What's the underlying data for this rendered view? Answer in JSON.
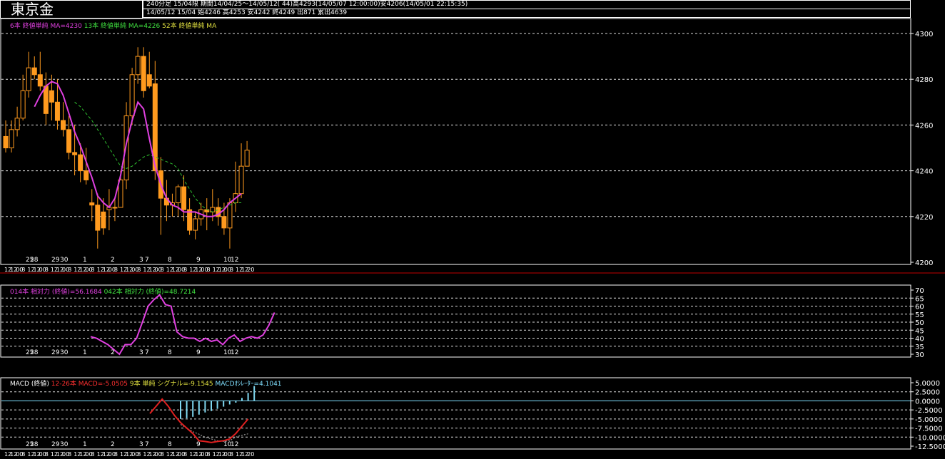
{
  "header": {
    "title": "東京金",
    "row1": "240分足 15/04限 期間14/04/25〜14/05/12( 44)高4293(14/05/07 12:00:00)安4206(14/05/01 22:15:35)",
    "row2": "14/05/12 15/04 始4246 高4253 安4242 終4249 出871 累出4639"
  },
  "colors": {
    "candle": "#ff9a1e",
    "ma6": "#e040e0",
    "ma13": "#30c030",
    "macd": "#e02020",
    "signal": "#b0b0b0",
    "hist": "#80d8f0",
    "frame": "#ffffff",
    "separator": "#c00000"
  },
  "main_panel": {
    "legend": {
      "ma6": "6本 終値単純 MA=4230",
      "ma13": "13本 終値単純 MA=4226",
      "ma52": "52本 終値単純 MA"
    },
    "y_ticks": [
      "4300",
      "4280",
      "4260",
      "4240",
      "4220",
      "4200"
    ],
    "day_labels": [
      "25",
      "28",
      "29",
      "30",
      "1",
      "2",
      "3",
      "7",
      "8",
      "9",
      "10",
      "12"
    ],
    "time_labels": [
      "12",
      "12",
      "00",
      "8",
      "12",
      "12",
      "00",
      "8",
      "12",
      "12",
      "00",
      "8",
      "12",
      "12",
      "00",
      "8",
      "12",
      "12",
      "00",
      "8",
      "12",
      "12",
      "00",
      "8",
      "12",
      "12",
      "00",
      "8",
      "12",
      "12",
      "00",
      "8",
      "12",
      "12",
      "00",
      "8",
      "12",
      "12",
      "00",
      "8",
      "12",
      "12",
      "20"
    ]
  },
  "rsi_panel": {
    "legend": {
      "rsi14": "014本 相対力 (終値)=56.1684",
      "rsi42": "042本 相対力 (終値)=48.7214"
    },
    "y_ticks": [
      "70",
      "65",
      "60",
      "55",
      "50",
      "45",
      "40",
      "35",
      "30"
    ],
    "day_labels": [
      "25",
      "28",
      "29",
      "30",
      "1",
      "2",
      "3",
      "7",
      "8",
      "9",
      "10",
      "12"
    ]
  },
  "macd_panel": {
    "legend": {
      "title": "MACD (終値)",
      "macd": "12-26本 MACD=-5.0505",
      "signal": "9本 単純 シグナル=-9.1545",
      "osc": "MACDｵｼﾚｰﾀｰ=4.1041"
    },
    "y_ticks": [
      "5.0000",
      "2.5000",
      "0.0000",
      "-2.5000",
      "-5.0000",
      "-7.5000",
      "-10.0000",
      "-12.5000"
    ],
    "day_labels": [
      "25",
      "28",
      "29",
      "30",
      "1",
      "2",
      "3",
      "7",
      "8",
      "9",
      "10",
      "12"
    ]
  },
  "chart_data": [
    {
      "type": "candlestick",
      "title": "東京金",
      "ylim": [
        4200,
        4300
      ],
      "series": [
        {
          "name": "price",
          "ohlc": [
            [
              4255,
              4262,
              4248,
              4250
            ],
            [
              4250,
              4262,
              4248,
              4258
            ],
            [
              4258,
              4268,
              4255,
              4263
            ],
            [
              4263,
              4282,
              4262,
              4275
            ],
            [
              4275,
              4292,
              4272,
              4285
            ],
            [
              4285,
              4290,
              4280,
              4282
            ],
            [
              4282,
              4292,
              4275,
              4277
            ],
            [
              4277,
              4283,
              4260,
              4265
            ],
            [
              4275,
              4282,
              4262,
              4270
            ],
            [
              4270,
              4280,
              4258,
              4262
            ],
            [
              4262,
              4270,
              4255,
              4258
            ],
            [
              4258,
              4264,
              4245,
              4248
            ],
            [
              4248,
              4260,
              4238,
              4247
            ],
            [
              4247,
              4252,
              4235,
              4240
            ],
            [
              4240,
              4250,
              4234,
              4236
            ],
            [
              4226,
              4232,
              4218,
              4225
            ],
            [
              4225,
              4230,
              4206,
              4214
            ],
            [
              4222,
              4228,
              4212,
              4215
            ],
            [
              4223,
              4232,
              4214,
              4224
            ],
            [
              4224,
              4228,
              4218,
              4224
            ],
            [
              4224,
              4240,
              4224,
              4236
            ],
            [
              4236,
              4270,
              4232,
              4264
            ],
            [
              4264,
              4285,
              4260,
              4282
            ],
            [
              4282,
              4294,
              4278,
              4290
            ],
            [
              4290,
              4294,
              4272,
              4275
            ],
            [
              4282,
              4292,
              4276,
              4277
            ],
            [
              4278,
              4288,
              4236,
              4240
            ],
            [
              4240,
              4246,
              4212,
              4228
            ],
            [
              4228,
              4236,
              4218,
              4225
            ],
            [
              4225,
              4230,
              4220,
              4226
            ],
            [
              4226,
              4234,
              4220,
              4233
            ],
            [
              4233,
              4238,
              4218,
              4223
            ],
            [
              4223,
              4228,
              4212,
              4214
            ],
            [
              4214,
              4222,
              4210,
              4219
            ],
            [
              4219,
              4226,
              4216,
              4223
            ],
            [
              4223,
              4228,
              4214,
              4222
            ],
            [
              4222,
              4232,
              4218,
              4224
            ],
            [
              4224,
              4228,
              4216,
              4220
            ],
            [
              4220,
              4226,
              4212,
              4215
            ],
            [
              4215,
              4228,
              4206,
              4226
            ],
            [
              4226,
              4244,
              4222,
              4230
            ],
            [
              4230,
              4252,
              4228,
              4242
            ],
            [
              4242,
              4253,
              4242,
              4249
            ]
          ]
        },
        {
          "name": "MA6",
          "values": [
            null,
            null,
            null,
            null,
            null,
            4268,
            4273,
            4277,
            4279,
            4278,
            4273,
            4265,
            4257,
            4251,
            4244,
            4237,
            4229,
            4226,
            4224,
            4228,
            4238,
            4252,
            4262,
            4270,
            4267,
            4254,
            4242,
            4234,
            4228,
            4225,
            4224,
            4222,
            4222,
            4222,
            4221,
            4220,
            4220,
            4221,
            4223,
            4226,
            4228,
            4230
          ]
        },
        {
          "name": "MA13",
          "values": [
            null,
            null,
            null,
            null,
            null,
            null,
            null,
            null,
            null,
            null,
            null,
            null,
            4270,
            4268,
            4265,
            4262,
            4258,
            4254,
            4250,
            4246,
            4242,
            4241,
            4242,
            4244,
            4246,
            4247,
            4246,
            4245,
            4244,
            4243,
            4241,
            4236,
            4232,
            4228,
            4225,
            4223,
            4222,
            4223,
            4224,
            4225,
            4226,
            4226
          ]
        }
      ]
    },
    {
      "type": "line",
      "title": "相対力",
      "ylim": [
        30,
        70
      ],
      "series": [
        {
          "name": "RSI14",
          "values": [
            null,
            null,
            null,
            null,
            null,
            null,
            null,
            null,
            null,
            null,
            null,
            null,
            null,
            null,
            null,
            null,
            null,
            null,
            null,
            null,
            41,
            40,
            38,
            36,
            33,
            30,
            36,
            36,
            40,
            50,
            60,
            64,
            67,
            61,
            60,
            44,
            41,
            40,
            40,
            38,
            40,
            38,
            39,
            36,
            40,
            42,
            38,
            40,
            41,
            40,
            42,
            48,
            56
          ]
        }
      ]
    },
    {
      "type": "line",
      "title": "MACD (終値)",
      "ylim": [
        -12.5,
        5
      ],
      "series": [
        {
          "name": "MACD",
          "values": [
            -3.5,
            -1.5,
            0.5,
            -1.5,
            -4,
            -6,
            -7.5,
            -9,
            -11,
            -11.2,
            -11.5,
            -11.2,
            -11,
            -10.5,
            -9,
            -7,
            -5
          ]
        },
        {
          "name": "signal",
          "values": [
            null,
            null,
            null,
            null,
            null,
            -6.5,
            -7.5,
            -8.5,
            -9.2,
            -10,
            -10.5,
            -11,
            -11.2,
            -11,
            -10,
            -9.5,
            -9.1
          ]
        },
        {
          "name": "oscillator",
          "values": [
            null,
            null,
            null,
            null,
            null,
            -5,
            -4.8,
            -4.4,
            -3.8,
            -3.2,
            -2.8,
            -2.2,
            -1.6,
            -1,
            -0.5,
            0.8,
            2.2,
            4.1
          ]
        }
      ]
    }
  ]
}
